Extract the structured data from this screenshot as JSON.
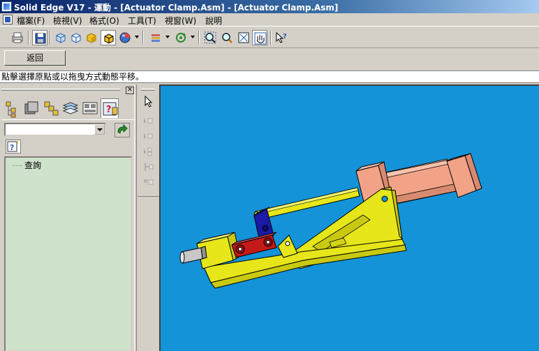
{
  "window": {
    "title": "Solid Edge V17 - 運動 - [Actuator Clamp.Asm] - [Actuator Clamp.Asm]"
  },
  "menu": {
    "items": [
      {
        "label": "檔案(F)"
      },
      {
        "label": "檢視(V)"
      },
      {
        "label": "格式(O)"
      },
      {
        "label": "工具(T)"
      },
      {
        "label": "視窗(W)"
      },
      {
        "label": "說明"
      }
    ]
  },
  "toolbar": {
    "icons": [
      "print-icon",
      "save-icon",
      "view-front-icon",
      "view-iso-icon",
      "shaded-icon",
      "shaded-edges-icon",
      "sphere-icon",
      "layers-icon",
      "rotate-icon",
      "zoom-area-icon",
      "zoom-icon",
      "fit-icon",
      "pan-icon",
      "help-pointer-icon"
    ]
  },
  "command_bar": {
    "back_label": "返回"
  },
  "prompt": {
    "text": "點擊選擇原點或以拖曳方式動態平移。"
  },
  "edgebar": {
    "tree_item": "查詢",
    "combo_value": ""
  },
  "colors": {
    "viewport_bg": "#1493d9",
    "part_yellow": "#e6e61a",
    "part_salmon": "#f5a58a",
    "part_red": "#c41a1a",
    "part_blue": "#1a1aa6",
    "tree_bg": "#cfe3cc"
  }
}
